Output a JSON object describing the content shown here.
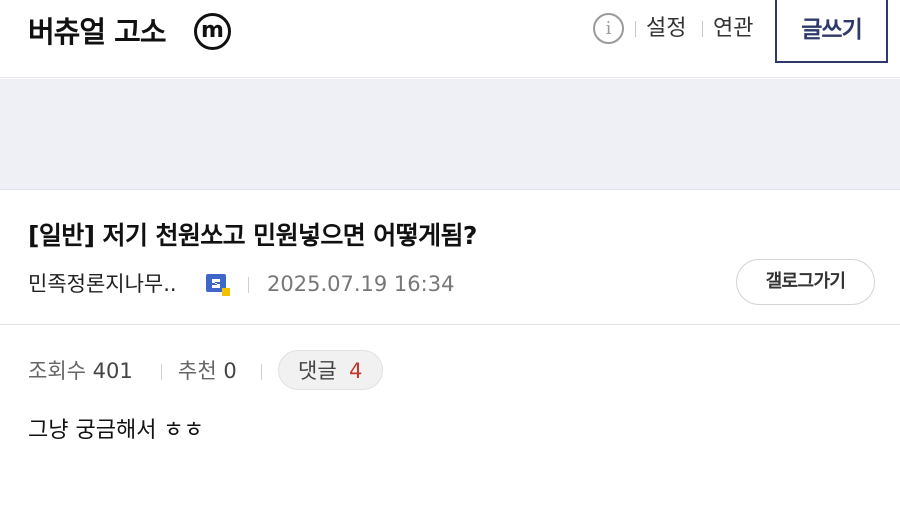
{
  "header": {
    "gallery_name": "버츄얼 고소",
    "badge_letter": "m",
    "info_icon": "info-icon",
    "settings_label": "설정",
    "related_label": "연관",
    "write_label": "글쓰기",
    "write_color": "#2d3a6a"
  },
  "post": {
    "title": "[일반] 저기 천원쏘고 민원넣으면 어떻게됨?",
    "author": "민족정론지나무..",
    "author_icon": "gallog-badge-icon",
    "date": "2025.07.19 16:34",
    "gallog_button": "갤로그가기",
    "views_label": "조회수",
    "views": "401",
    "recommend_label": "추천",
    "recommend": "0",
    "comments_label": "댓글",
    "comments": "4",
    "comments_color": "#c0392b",
    "body": "그냥 궁금해서 ㅎㅎ"
  }
}
